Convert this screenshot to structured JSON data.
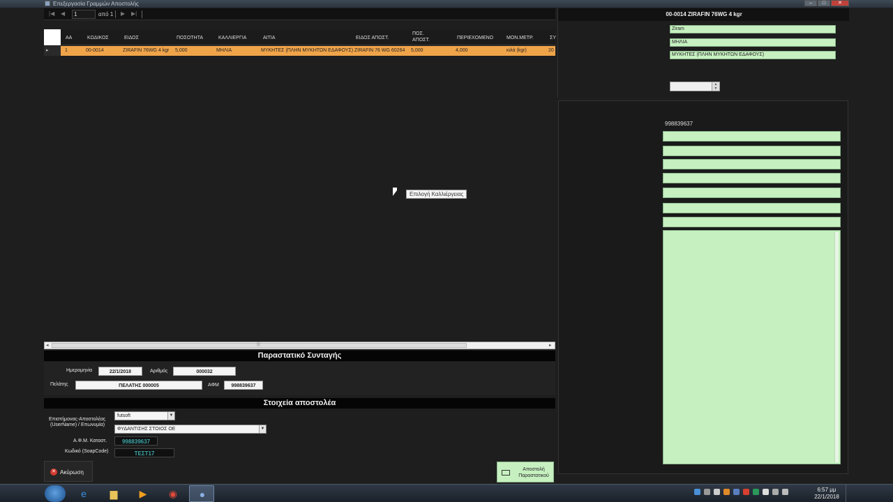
{
  "window": {
    "title": "Επεξεργασία Γραμμών Αποστολής"
  },
  "navigator": {
    "position": "1",
    "of_label": "από 1"
  },
  "grid": {
    "columns": [
      {
        "label": "ΑΑ"
      },
      {
        "label": "ΚΩΔΙΚΟΣ"
      },
      {
        "label": "ΕΙΔΟΣ"
      },
      {
        "label": "ΠΟΣΟΤΗΤΑ"
      },
      {
        "label": "ΚΑΛΛΙΕΡΓΙΑ"
      },
      {
        "label": "ΑΙΤΙΑ"
      },
      {
        "label": "ΕΙΔΟΣ ΑΠΟΣΤ."
      },
      {
        "label": "ΠΟΣ. ΑΠΟΣΤ."
      },
      {
        "label": "ΠΕΡΙΕΧΟΜΕΝΟ"
      },
      {
        "label": "ΜΟΝ.ΜΕΤΡ."
      },
      {
        "label": "ΣΥ"
      }
    ],
    "rows": [
      [
        "1",
        "00-0014",
        "ZIRAFIN 76WG 4 kgr",
        "5,000",
        "ΜΗΛΙΑ",
        "ΜΥΚΗΤΕΣ (ΠΛΗΝ ΜΥΚΗΤΩΝ ΕΔΑΦΟΥΣ)",
        "ZIRAFIN 76 WG 60264",
        "5,000",
        "4,000",
        "κιλά (kgr)",
        "20"
      ]
    ]
  },
  "tooltip": "Επιλογή Καλλιέργειας",
  "prescription": {
    "heading": "Παραστατικό Συνταγής",
    "date_label": "Ημερομηνία",
    "date": "22/1/2018",
    "number_label": "Αριθμός",
    "number": "000032",
    "customer_label": "Πελάτης",
    "customer": "ΠΕΛΑΤΗΣ 000005",
    "afm_label": "ΑΦΜ",
    "afm": "998839637"
  },
  "sender": {
    "heading": "Στοιχεία αποστολέα",
    "user_label_1": "Επιστήμονας-Αποστολέας",
    "user_label_2": "(UserName) / Επωνυμία)",
    "username": "futsoft",
    "company": "ΦΥΔΑΝΤΙΣΗΣ ΣΤΟΙΟΣ ΟΕ",
    "store_afm_label": "Α.Φ.Μ. Καταστ.",
    "store_afm": "998839637",
    "code_label": "Κωδικό (SoapCode)",
    "code": "ΤΕΣΤ17"
  },
  "buttons": {
    "cancel": "Ακύρωση",
    "send_line1": "Αποστολή",
    "send_line2": "Παραστατικού"
  },
  "detail": {
    "title": "00-0014  ZIRAFIN 76WG 4 kgr",
    "field1": "Ziram",
    "field2": "ΜΗΛΙΑ",
    "field3": "ΜΥΚΗΤΕΣ (ΠΛΗΝ ΜΥΚΗΤΩΝ ΕΔΑΦΟΥΣ)",
    "afm": "998839637"
  },
  "taskbar": {
    "time": "6:57 μμ",
    "date": "22/1/2018"
  },
  "colors": {
    "selected_row": "#f0a44a",
    "green_field": "#c6f0c0",
    "background": "#1e1e1e"
  }
}
